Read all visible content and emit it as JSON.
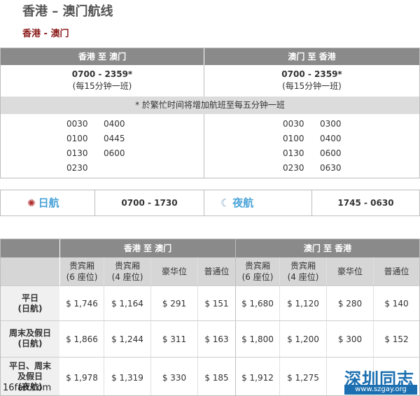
{
  "page": {
    "title": "香港 – 澳门航线",
    "subtitle": "香港 - 澳门"
  },
  "schedule": {
    "col1_header": "香港 至 澳门",
    "col2_header": "澳门 至 香港",
    "col1_hours": "0700 - 2359*",
    "col1_freq": "(每15分钟一班)",
    "col2_hours": "0700 - 2359*",
    "col2_freq": "(每15分钟一班)",
    "note": "* 於繁忙时间将增加航班至每五分钟一班",
    "col1_times_a": [
      "0030",
      "0100",
      "0130",
      "0230"
    ],
    "col1_times_b": [
      "0400",
      "0445",
      "0600"
    ],
    "col2_times_a": [
      "0030",
      "0100",
      "0130",
      "0230"
    ],
    "col2_times_b": [
      "0300",
      "0400",
      "0600",
      "0630"
    ]
  },
  "daynight": {
    "day_label": "日航",
    "day_hours": "0700 - 1730",
    "night_label": "夜航",
    "night_hours": "1745 - 0630"
  },
  "fares": {
    "dir1": "香港 至 澳门",
    "dir2": "澳门 至 香港",
    "classes": [
      {
        "l1": "贵宾厢",
        "l2": "(6 座位)"
      },
      {
        "l1": "贵宾厢",
        "l2": "(4 座位)"
      },
      {
        "l1": "豪华位",
        "l2": ""
      },
      {
        "l1": "普通位",
        "l2": ""
      }
    ],
    "rows": [
      {
        "label1": "平日",
        "label2": "(日航)",
        "label3": "",
        "prices": [
          "$ 1,746",
          "$ 1,164",
          "$ 291",
          "$ 151",
          "$ 1,680",
          "$ 1,120",
          "$ 280",
          "$ 140"
        ]
      },
      {
        "label1": "周末及假日",
        "label2": "(日航)",
        "label3": "",
        "prices": [
          "$ 1,866",
          "$ 1,244",
          "$ 311",
          "$ 163",
          "$ 1,800",
          "$ 1,200",
          "$ 300",
          "$ 152"
        ]
      },
      {
        "label1": "平日、周末",
        "label2": "及假日",
        "label3": "(夜航)",
        "prices": [
          "$ 1,978",
          "$ 1,319",
          "$ 330",
          "$ 185",
          "$ 1,912",
          "$ 1,275",
          "",
          ""
        ]
      }
    ]
  },
  "watermarks": {
    "right_title": "深圳同志",
    "right_url": "www.szgay.org",
    "left": "16fan.com"
  },
  "colors": {
    "header_bg": "#8a8a8a",
    "subtitle": "#8b1a1a",
    "accent_label": "#4aa3d8"
  }
}
